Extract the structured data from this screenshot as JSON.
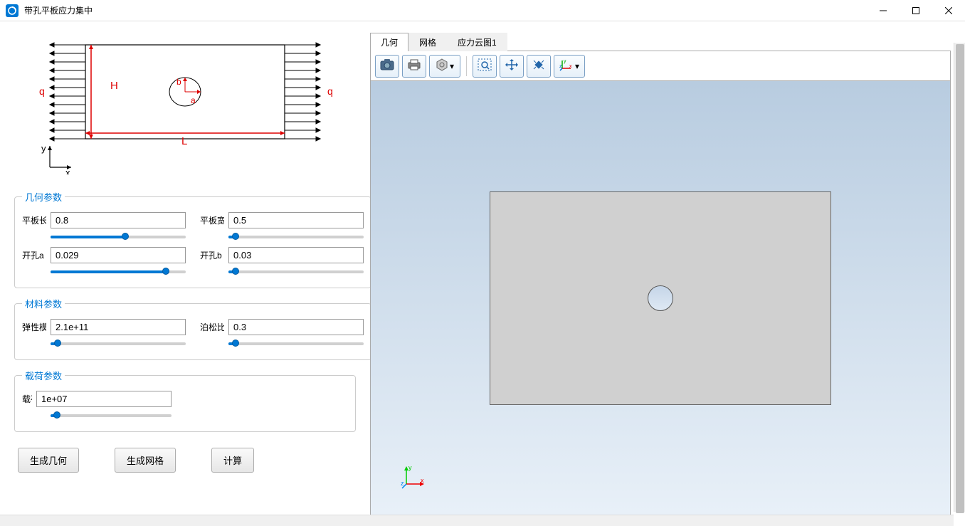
{
  "window": {
    "title": "带孔平板应力集中"
  },
  "diagram": {
    "q_left": "q",
    "q_right": "q",
    "H": "H",
    "L": "L",
    "a": "a",
    "b": "b",
    "y": "y",
    "x": "x"
  },
  "groups": {
    "geometry": {
      "legend": "几何参数",
      "params": [
        {
          "label": "平板长",
          "value": "0.8",
          "fill": 55
        },
        {
          "label": "平板宽",
          "value": "0.5",
          "fill": 5
        },
        {
          "label": "开孔a",
          "value": "0.029",
          "fill": 85
        },
        {
          "label": "开孔b",
          "value": "0.03",
          "fill": 5
        }
      ]
    },
    "material": {
      "legend": "材料参数",
      "params": [
        {
          "label": "弹性模",
          "value": "2.1e+11",
          "fill": 5
        },
        {
          "label": "泊松比",
          "value": "0.3",
          "fill": 5
        }
      ]
    },
    "load": {
      "legend": "载荷参数",
      "params": [
        {
          "label": "载荷",
          "value": "1e+07",
          "fill": 5
        }
      ]
    }
  },
  "buttons": {
    "gen_geom": "生成几何",
    "gen_mesh": "生成网格",
    "compute": "计算"
  },
  "tabs": [
    {
      "label": "几何",
      "active": true
    },
    {
      "label": "网格",
      "active": false
    },
    {
      "label": "应力云图1",
      "active": false
    }
  ],
  "toolbar_icons": {
    "camera": "camera-icon",
    "print": "print-icon",
    "sphere": "render-mode-icon",
    "zoom_box": "zoom-box-icon",
    "pan": "pan-icon",
    "fit": "fit-view-icon",
    "axis": "axis-orient-icon"
  },
  "axis_labels": {
    "x": "x",
    "y": "y",
    "z": "z"
  }
}
